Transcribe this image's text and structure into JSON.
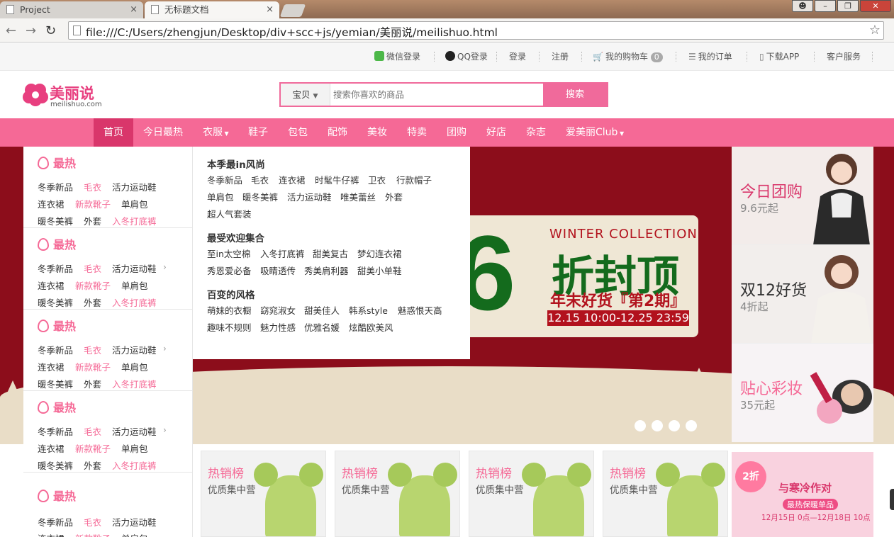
{
  "browser": {
    "tabs": [
      {
        "title": "Project"
      },
      {
        "title": "无标题文档"
      }
    ],
    "close_glyph": "×",
    "url": "file:///C:/Users/zhengjun/Desktop/div+scc+js/yemian/美丽说/meilishuo.html"
  },
  "topbar": {
    "wechat_login": "微信登录",
    "qq_login": "QQ登录",
    "login": "登录",
    "register": "注册",
    "cart": "我的购物车",
    "cart_count": "0",
    "orders": "我的订单",
    "download_app": "下载APP",
    "service": "客户服务"
  },
  "logo": {
    "cn": "美丽说",
    "en": "meilishuo.com"
  },
  "search": {
    "scope": "宝贝",
    "placeholder": "搜索你喜欢的商品",
    "button": "搜索"
  },
  "nav": [
    {
      "label": "首页"
    },
    {
      "label": "今日最热"
    },
    {
      "label": "衣服"
    },
    {
      "label": "鞋子"
    },
    {
      "label": "包包"
    },
    {
      "label": "配饰"
    },
    {
      "label": "美妆"
    },
    {
      "label": "特卖"
    },
    {
      "label": "团购"
    },
    {
      "label": "好店"
    },
    {
      "label": "杂志"
    },
    {
      "label": "爱美丽Club"
    }
  ],
  "category_sidebar": {
    "heading": "最热",
    "rows": [
      [
        "冬季新品",
        "毛衣",
        "活力运动鞋"
      ],
      [
        "连衣裙",
        "新款靴子",
        "单肩包"
      ],
      [
        "暖冬美裤",
        "外套",
        "入冬打底裤"
      ]
    ]
  },
  "submenu": {
    "groups": [
      {
        "title": "本季最in风尚",
        "items": [
          [
            "冬季新品",
            "毛衣",
            "连衣裙",
            "时髦牛仔裤",
            "卫衣",
            "行款帽子"
          ],
          [
            "单肩包",
            "暖冬美裤",
            "活力运动鞋",
            "唯美蕾丝",
            "外套"
          ],
          [
            "超人气套装"
          ]
        ]
      },
      {
        "title": "最受欢迎集合",
        "items": [
          [
            "至in太空棉",
            "入冬打底裤",
            "甜美复古",
            "梦幻连衣裙"
          ],
          [
            "秀恩爱必备",
            "吸睛透传",
            "秀美肩利器",
            "甜美小单鞋"
          ]
        ]
      },
      {
        "title": "百变的风格",
        "items": [
          [
            "萌妹的衣橱",
            "窈窕淑女",
            "甜美佳人",
            "韩系style",
            "魅惑恨天高"
          ],
          [
            "趣味不规则",
            "魅力性感",
            "优雅名媛",
            "炫酷欧美风"
          ]
        ]
      }
    ]
  },
  "banner": {
    "english": "WINTER COLLECTION",
    "big_number": "6",
    "headline": "折封顶",
    "subline": "年末好货『第2期』",
    "dates": "12.15 10:00-12.25 23:59"
  },
  "right_cards": [
    {
      "title": "今日团购",
      "sub": "9.6元起",
      "color": "#d9366b"
    },
    {
      "title": "双12好货",
      "sub": "4折起",
      "color": "#333333"
    },
    {
      "title": "贴心彩妆",
      "sub": "35元起",
      "color": "#f56996"
    }
  ],
  "products": [
    {
      "title": "热销榜",
      "sub": "优质集中营"
    },
    {
      "title": "热销榜",
      "sub": "优质集中营"
    },
    {
      "title": "热销榜",
      "sub": "优质集中营"
    },
    {
      "title": "热销榜",
      "sub": "优质集中营"
    }
  ],
  "ad": {
    "badge": "2折",
    "headline": "与寒冷作对",
    "sub": "最热保暖单品",
    "dates": "12月15日 0点—12月18日 10点"
  },
  "colors": {
    "brand_pink": "#f56996",
    "nav_active": "#d9366b",
    "banner_red": "#8c0d1b"
  }
}
